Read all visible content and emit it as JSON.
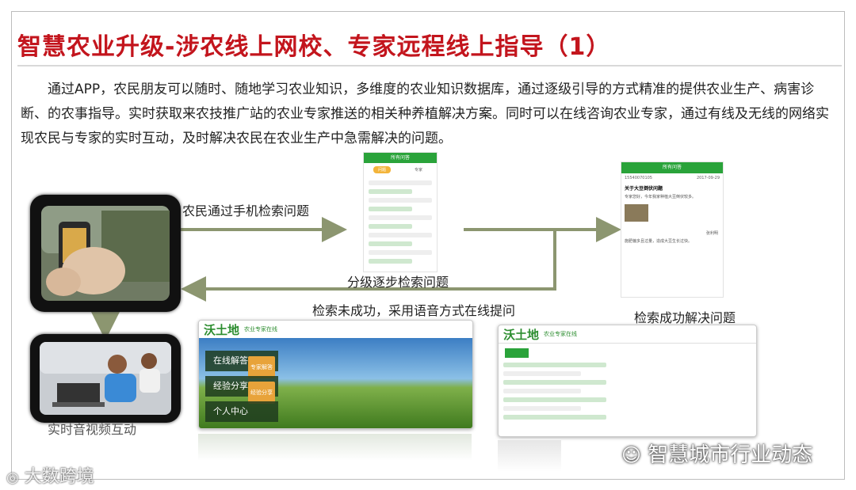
{
  "title": "智慧农业升级-涉农线上网校、专家远程线上指导（1）",
  "paragraph": "通过APP，农民朋友可以随时、随地学习农业知识，多维度的农业知识数据库，通过逐级引导的方式精准的提供农业生产、病害诊断、的农事指导。实时获取来农技推广站的农业专家推送的相关种养植解决方案。同时可以在线咨询农业专家，通过有线及无线的网络实现农民与专家的实时互动，及时解决农民在农业生产中急需解决的问题。",
  "labels": {
    "search_by_phone": "农民通过手机检索问题",
    "step_search": "分级逐步检索问题",
    "voice_online": "检索未成功，采用语音方式在线提问",
    "search_success": "检索成功解决问题",
    "video_interaction": "实时音视频互动"
  },
  "phone_center": {
    "header": "所有问答",
    "tabs": [
      "问题",
      "专家"
    ]
  },
  "phone_right": {
    "header": "所有问答",
    "user": "15540070105",
    "date": "2017-09-29",
    "question": "关于大豆倒伏问题",
    "body": "专家您好，今年我家种植大豆倒伏较多。",
    "reply_user": "张利明",
    "reply": "施肥偏多且过量，造成大豆生长过快。"
  },
  "web_left": {
    "logo": "沃土地",
    "subtitle": "农业专家在线",
    "menu": [
      "在线解答",
      "经验分享",
      "个人中心"
    ],
    "tag1": "专家解答",
    "tag2": "经验分享"
  },
  "web_right": {
    "logo": "沃土地",
    "subtitle": "农业专家在线"
  },
  "watermarks": {
    "left": "大数跨境",
    "right": "智慧城市行业动态"
  },
  "colors": {
    "title": "#c3151d",
    "arrow": "#8c9670",
    "green": "#2aa33a"
  }
}
